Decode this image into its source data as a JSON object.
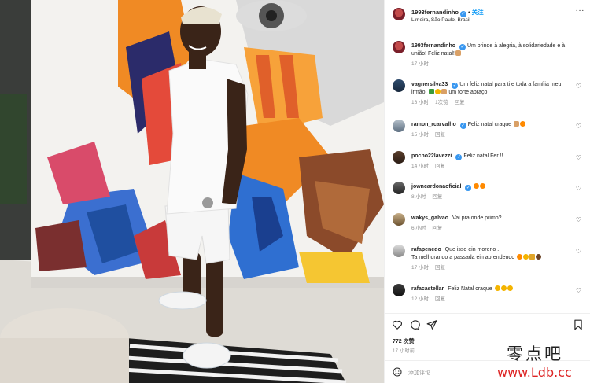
{
  "post": {
    "username": "1993fernandinho",
    "follow_label": "关注",
    "location": "Limeira, São Paulo, Brasil",
    "more_label": "···"
  },
  "caption": {
    "username": "1993fernandinho",
    "text": "Um brinde à alegria, à solidariedade e à união! Feliz natal!",
    "time": "17 小时"
  },
  "comments": [
    {
      "username": "vagnersilva33",
      "text": "Um feliz natal para ti e toda a família meu irmão!",
      "text2": "um forte abraço",
      "time": "16 小时",
      "likes": "1次赞",
      "reply": "回复"
    },
    {
      "username": "ramon_rcarvalho",
      "text": "Feliz natal craque",
      "time": "15 小时",
      "reply": "回复"
    },
    {
      "username": "pocho22lavezzi",
      "text": "Feliz natal Fer !!",
      "time": "14 小时",
      "reply": "回复"
    },
    {
      "username": "jowncardonaoficial",
      "text": "",
      "time": "8 小时",
      "reply": "回复"
    },
    {
      "username": "wakys_galvao",
      "text": "Vai pra onde primo?",
      "time": "6 小时",
      "reply": "回复"
    },
    {
      "username": "rafapenedo",
      "text": "Que isso ein moreno .",
      "text2": "Ta melhorando a passada ein aprendendo",
      "time": "17 小时",
      "reply": "回复"
    },
    {
      "username": "rafacastellar",
      "text": "Feliz Natal craque",
      "time": "12 小时",
      "reply": "回复"
    }
  ],
  "stats": {
    "likes": "772 次赞",
    "time": "17 小时前"
  },
  "add_comment": {
    "placeholder": "添加评论..."
  },
  "watermark": {
    "chinese": "零点吧",
    "url": "www.Ldb.cc"
  },
  "colors": {
    "accent": "#0095f6",
    "verified": "#3897f0",
    "watermark_url": "#dd2222"
  },
  "icons": [
    "heart-icon",
    "comment-icon",
    "share-icon",
    "bookmark-icon",
    "smile-icon",
    "more-icon",
    "verified-icon"
  ]
}
